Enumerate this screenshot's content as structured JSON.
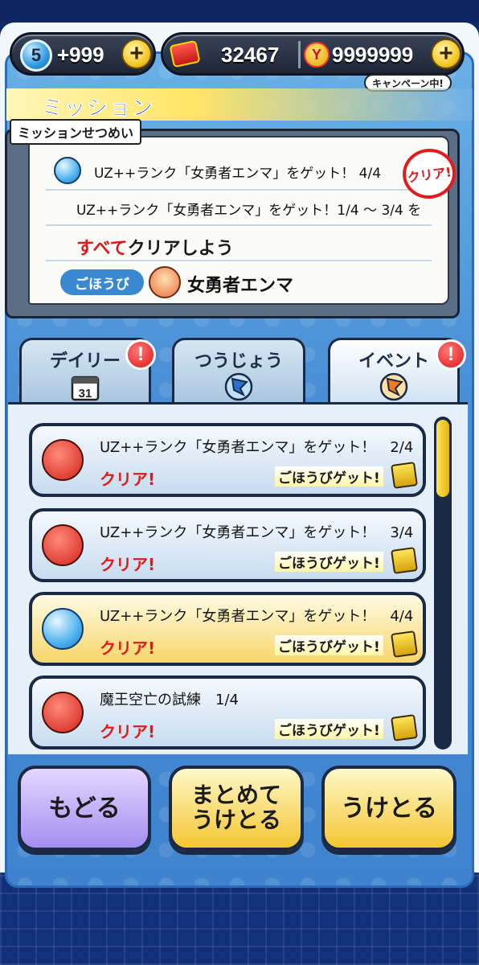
{
  "status_bar": {
    "stamina_level": "5",
    "stamina_value": "+999",
    "ticket_count": "32467",
    "ycoin_count": "9999999",
    "campaign_label": "キャンペーン中!"
  },
  "header": {
    "title": "ミッション"
  },
  "description": {
    "caption": "ミッションせつめい",
    "mission_title": "UZ++ランク「女勇者エンマ」をゲット！ 4/4",
    "body_line1": "UZ++ランク「女勇者エンマ」をゲット！1/4 ～ 3/4 を",
    "body_line2_red": "すべて",
    "body_line2_rest": "クリアしよう",
    "reward_label": "ごほうび",
    "reward_name": "女勇者エンマ",
    "clear_stamp": "クリア!"
  },
  "tabs": [
    {
      "label": "デイリー",
      "icon": "calendar-icon",
      "alert": "!",
      "active": false
    },
    {
      "label": "つうじょう",
      "icon": "blue-flag-icon",
      "alert": "",
      "active": false
    },
    {
      "label": "イベント",
      "icon": "orange-flag-icon",
      "alert": "!",
      "active": true
    }
  ],
  "missions": [
    {
      "title": "UZ++ランク「女勇者エンマ」をゲット！　2/4",
      "status": "クリア!",
      "reward": "ごほうびゲット!",
      "icon": "yokai-face-icon"
    },
    {
      "title": "UZ++ランク「女勇者エンマ」をゲット！　3/4",
      "status": "クリア!",
      "reward": "ごほうびゲット!",
      "icon": "yokai-face-icon"
    },
    {
      "title": "UZ++ランク「女勇者エンマ」をゲット！　4/4",
      "status": "クリア!",
      "reward": "ごほうびゲット!",
      "icon": "soul-orb-icon"
    },
    {
      "title": "魔王空亡の試練　1/4",
      "status": "クリア!",
      "reward": "ごほうびゲット!",
      "icon": "yokai-face-icon"
    }
  ],
  "buttons": {
    "back": "もどる",
    "bulk_line1": "まとめて",
    "bulk_line2": "うけとる",
    "receive": "うけとる"
  },
  "colors": {
    "accent_yellow": "#f3c632",
    "clear_red": "#e01a1a",
    "panel_blue": "#4a8fd6"
  }
}
